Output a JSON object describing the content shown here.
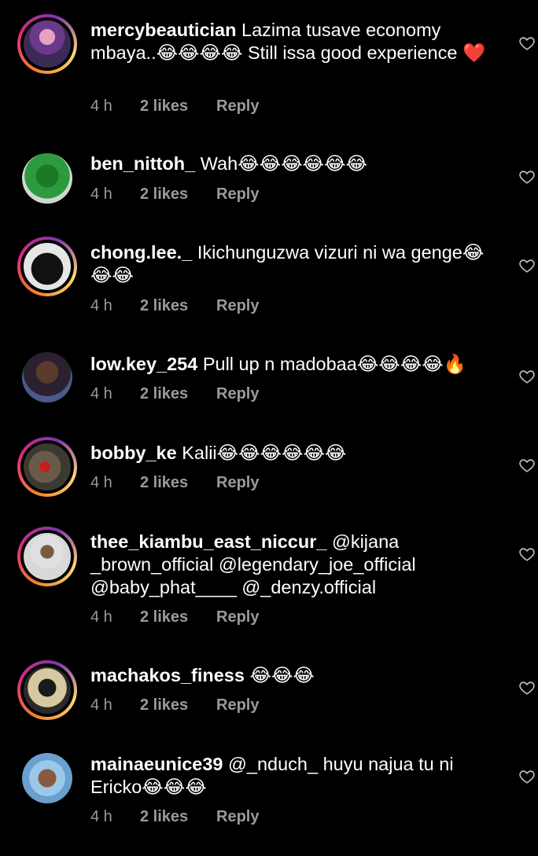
{
  "comments": [
    {
      "username": "mercybeautician",
      "text": "Lazima tusave economy mbaya..😂😂😂😂 Still issa good experience ❤️",
      "time": "4 h",
      "likes": "2 likes",
      "reply": "Reply",
      "story_ring": true
    },
    {
      "username": "ben_nittoh_",
      "text": "Wah😂😂😂😂😂😂",
      "time": "4 h",
      "likes": "2 likes",
      "reply": "Reply",
      "story_ring": false
    },
    {
      "username": "chong.lee._",
      "text": "Ikichunguzwa vizuri ni wa genge😂😂😂",
      "time": "4 h",
      "likes": "2 likes",
      "reply": "Reply",
      "story_ring": true
    },
    {
      "username": "low.key_254",
      "text": "Pull up n madobaa😂😂😂😂🔥",
      "time": "4 h",
      "likes": "2 likes",
      "reply": "Reply",
      "story_ring": false
    },
    {
      "username": "bobby_ke",
      "text": "Kalii😂😂😂😂😂😂",
      "time": "4 h",
      "likes": "2 likes",
      "reply": "Reply",
      "story_ring": true
    },
    {
      "username": "thee_kiambu_east_niccur_",
      "text": "@kijana _brown_official @legendary_joe_official @baby_phat____ @_denzy.official",
      "time": "4 h",
      "likes": "2 likes",
      "reply": "Reply",
      "story_ring": true
    },
    {
      "username": "machakos_finess",
      "text": "😂😂😂",
      "time": "4 h",
      "likes": "2 likes",
      "reply": "Reply",
      "story_ring": true
    },
    {
      "username": "mainaeunice39",
      "text": "@_nduch_ huyu najua tu ni Ericko😂😂😂",
      "time": "4 h",
      "likes": "2 likes",
      "reply": "Reply",
      "story_ring": false
    }
  ],
  "icons": {
    "like": "heart-outline-icon",
    "avatar": "user-avatar"
  },
  "colors": {
    "background": "#000000",
    "meta": "#9a9a9a",
    "ring_start": "#f58529",
    "ring_mid": "#dd2a7b",
    "ring_end": "#8134af"
  }
}
